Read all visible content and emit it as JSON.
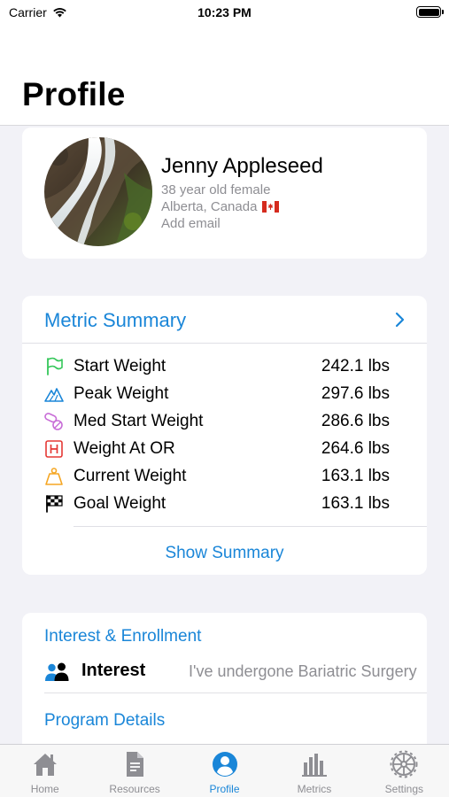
{
  "status_bar": {
    "carrier": "Carrier",
    "time": "10:23 PM"
  },
  "header": {
    "title": "Profile"
  },
  "profile": {
    "name": "Jenny Appleseed",
    "age_gender": "38 year old female",
    "location": "Alberta, Canada",
    "email_prompt": "Add email",
    "flag_icon": "canada-flag-icon"
  },
  "metric_summary": {
    "title": "Metric Summary",
    "rows": [
      {
        "icon": "flag-icon",
        "label": "Start Weight",
        "value": "242.1 lbs",
        "color": "#34c759"
      },
      {
        "icon": "mountain-icon",
        "label": "Peak Weight",
        "value": "297.6 lbs",
        "color": "#1a86d8"
      },
      {
        "icon": "pill-icon",
        "label": "Med Start Weight",
        "value": "286.6 lbs",
        "color": "#c86dd7"
      },
      {
        "icon": "hospital-icon",
        "label": "Weight At OR",
        "value": "264.6 lbs",
        "color": "#e53935"
      },
      {
        "icon": "scale-weight-icon",
        "label": "Current Weight",
        "value": "163.1 lbs",
        "color": "#f5a623"
      },
      {
        "icon": "checkered-flag-icon",
        "label": "Goal Weight",
        "value": "163.1 lbs",
        "color": "#000000"
      }
    ],
    "show_summary": "Show Summary"
  },
  "interest": {
    "title": "Interest & Enrollment",
    "label": "Interest",
    "value": "I've undergone Bariatric Surgery",
    "program_title": "Program Details"
  },
  "tabs": [
    {
      "label": "Home",
      "icon": "house-icon",
      "active": false
    },
    {
      "label": "Resources",
      "icon": "document-icon",
      "active": false
    },
    {
      "label": "Profile",
      "icon": "person-circle-icon",
      "active": true
    },
    {
      "label": "Metrics",
      "icon": "bar-chart-icon",
      "active": false
    },
    {
      "label": "Settings",
      "icon": "gear-icon",
      "active": false
    }
  ],
  "colors": {
    "accent": "#1a86d8",
    "secondary_text": "#8e8e93",
    "background": "#f2f2f7"
  }
}
